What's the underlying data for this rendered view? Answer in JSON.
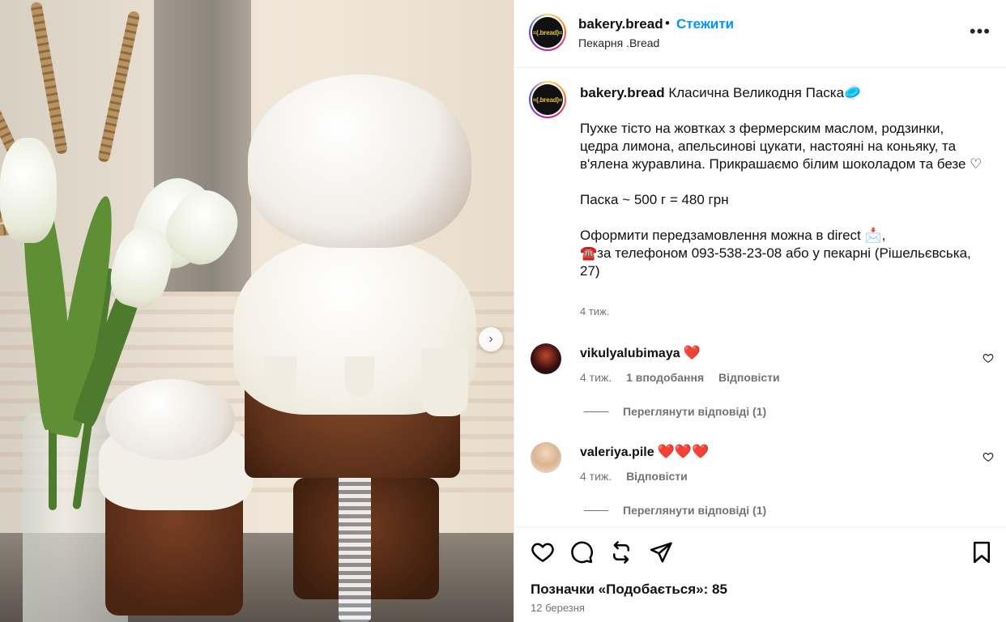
{
  "post": {
    "author": "bakery.bread",
    "follow_label": "Стежити",
    "subtitle": "Пекарня .Bread",
    "avatar_text": "≈(.bread)≈",
    "more_icon": "more-horizontal-icon",
    "caption": {
      "title": "Класична Великодня Паска🥏",
      "paragraph1": "Пухке тісто на жовтках з фермерским маслом, родзинки, цедра лимона, апельсинові цукати, настояні на коньяку, та в'ялена журавлина. Прикрашаємо білим шоколадом та безе ♡",
      "paragraph2": "Паска ~ 500 г = 480 грн",
      "paragraph3a": "Оформити передзамовлення можна в direct 📩,",
      "paragraph3b": "☎️за телефоном 093-538-23-08 або у пекарні (Рішельєвська, 27)",
      "time": "4 тиж."
    }
  },
  "comments": [
    {
      "user": "vikulyalubimaya",
      "hearts": "❤️",
      "time": "4 тиж.",
      "likes": "1 вподобання",
      "reply_label": "Відповісти",
      "view_replies": "Переглянути відповіді (1)"
    },
    {
      "user": "valeriya.pile",
      "hearts": "❤️❤️❤️",
      "time": "4 тиж.",
      "reply_label": "Відповісти",
      "view_replies": "Переглянути відповіді (1)"
    }
  ],
  "footer": {
    "likes_text": "Позначки «Подобається»: 85",
    "date": "12 березня"
  },
  "carousel": {
    "next_icon": "chevron-right-icon"
  },
  "colors": {
    "accent": "#0095f6",
    "secondary_text": "#737373",
    "heart": "#e0245e"
  }
}
